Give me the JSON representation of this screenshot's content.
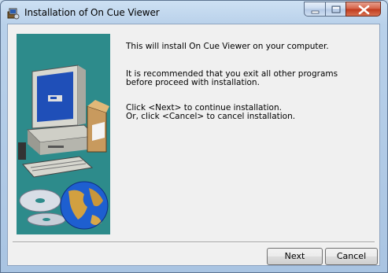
{
  "window": {
    "title": "Installation of On Cue Viewer"
  },
  "body": {
    "line1": "This will install On Cue Viewer on your computer.",
    "line2": "It is recommended that you exit all other programs\nbefore proceed with installation.",
    "line3": "Click <Next> to continue installation.\nOr, click <Cancel> to cancel installation."
  },
  "buttons": {
    "next_label": "Next",
    "cancel_label": "Cancel"
  },
  "colors": {
    "illustration_bg": "#2d8b8b",
    "close_button": "#c0391c"
  },
  "icons": {
    "title_icon": "installer-icon",
    "illustration": "computer-with-cd-and-globe"
  }
}
